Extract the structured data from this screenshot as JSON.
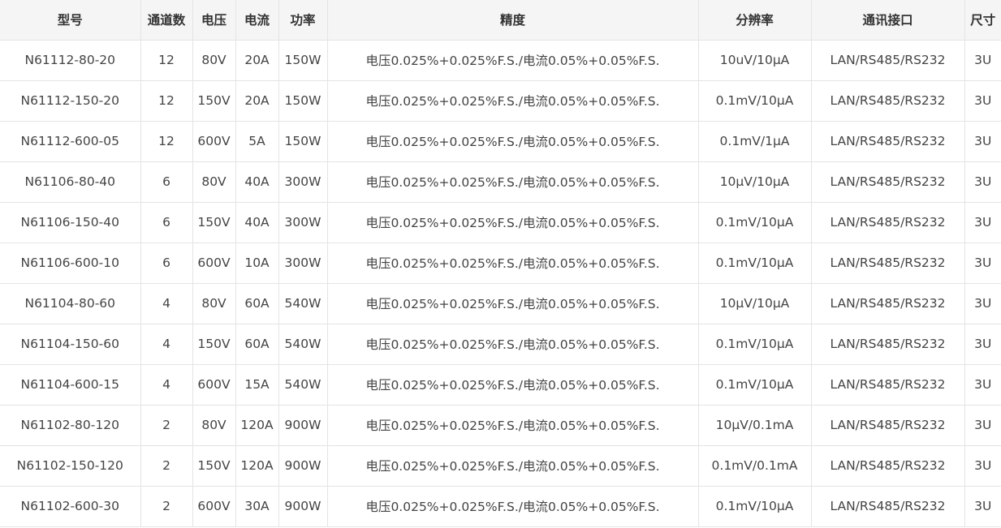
{
  "table": {
    "headers": [
      "型号",
      "通道数",
      "电压",
      "电流",
      "功率",
      "精度",
      "分辨率",
      "通讯接口",
      "尺寸"
    ],
    "rows": [
      [
        "N61112-80-20",
        "12",
        "80V",
        "20A",
        "150W",
        "电压0.025%+0.025%F.S./电流0.05%+0.05%F.S.",
        "10uV/10μA",
        "LAN/RS485/RS232",
        "3U"
      ],
      [
        "N61112-150-20",
        "12",
        "150V",
        "20A",
        "150W",
        "电压0.025%+0.025%F.S./电流0.05%+0.05%F.S.",
        "0.1mV/10μA",
        "LAN/RS485/RS232",
        "3U"
      ],
      [
        "N61112-600-05",
        "12",
        "600V",
        "5A",
        "150W",
        "电压0.025%+0.025%F.S./电流0.05%+0.05%F.S.",
        "0.1mV/1μA",
        "LAN/RS485/RS232",
        "3U"
      ],
      [
        "N61106-80-40",
        "6",
        "80V",
        "40A",
        "300W",
        "电压0.025%+0.025%F.S./电流0.05%+0.05%F.S.",
        "10μV/10μA",
        "LAN/RS485/RS232",
        "3U"
      ],
      [
        "N61106-150-40",
        "6",
        "150V",
        "40A",
        "300W",
        "电压0.025%+0.025%F.S./电流0.05%+0.05%F.S.",
        "0.1mV/10μA",
        "LAN/RS485/RS232",
        "3U"
      ],
      [
        "N61106-600-10",
        "6",
        "600V",
        "10A",
        "300W",
        "电压0.025%+0.025%F.S./电流0.05%+0.05%F.S.",
        "0.1mV/10μA",
        "LAN/RS485/RS232",
        "3U"
      ],
      [
        "N61104-80-60",
        "4",
        "80V",
        "60A",
        "540W",
        "电压0.025%+0.025%F.S./电流0.05%+0.05%F.S.",
        "10μV/10μA",
        "LAN/RS485/RS232",
        "3U"
      ],
      [
        "N61104-150-60",
        "4",
        "150V",
        "60A",
        "540W",
        "电压0.025%+0.025%F.S./电流0.05%+0.05%F.S.",
        "0.1mV/10μA",
        "LAN/RS485/RS232",
        "3U"
      ],
      [
        "N61104-600-15",
        "4",
        "600V",
        "15A",
        "540W",
        "电压0.025%+0.025%F.S./电流0.05%+0.05%F.S.",
        "0.1mV/10μA",
        "LAN/RS485/RS232",
        "3U"
      ],
      [
        "N61102-80-120",
        "2",
        "80V",
        "120A",
        "900W",
        "电压0.025%+0.025%F.S./电流0.05%+0.05%F.S.",
        "10μV/0.1mA",
        "LAN/RS485/RS232",
        "3U"
      ],
      [
        "N61102-150-120",
        "2",
        "150V",
        "120A",
        "900W",
        "电压0.025%+0.025%F.S./电流0.05%+0.05%F.S.",
        "0.1mV/0.1mA",
        "LAN/RS485/RS232",
        "3U"
      ],
      [
        "N61102-600-30",
        "2",
        "600V",
        "30A",
        "900W",
        "电压0.025%+0.025%F.S./电流0.05%+0.05%F.S.",
        "0.1mV/10μA",
        "LAN/RS485/RS232",
        "3U"
      ]
    ]
  }
}
